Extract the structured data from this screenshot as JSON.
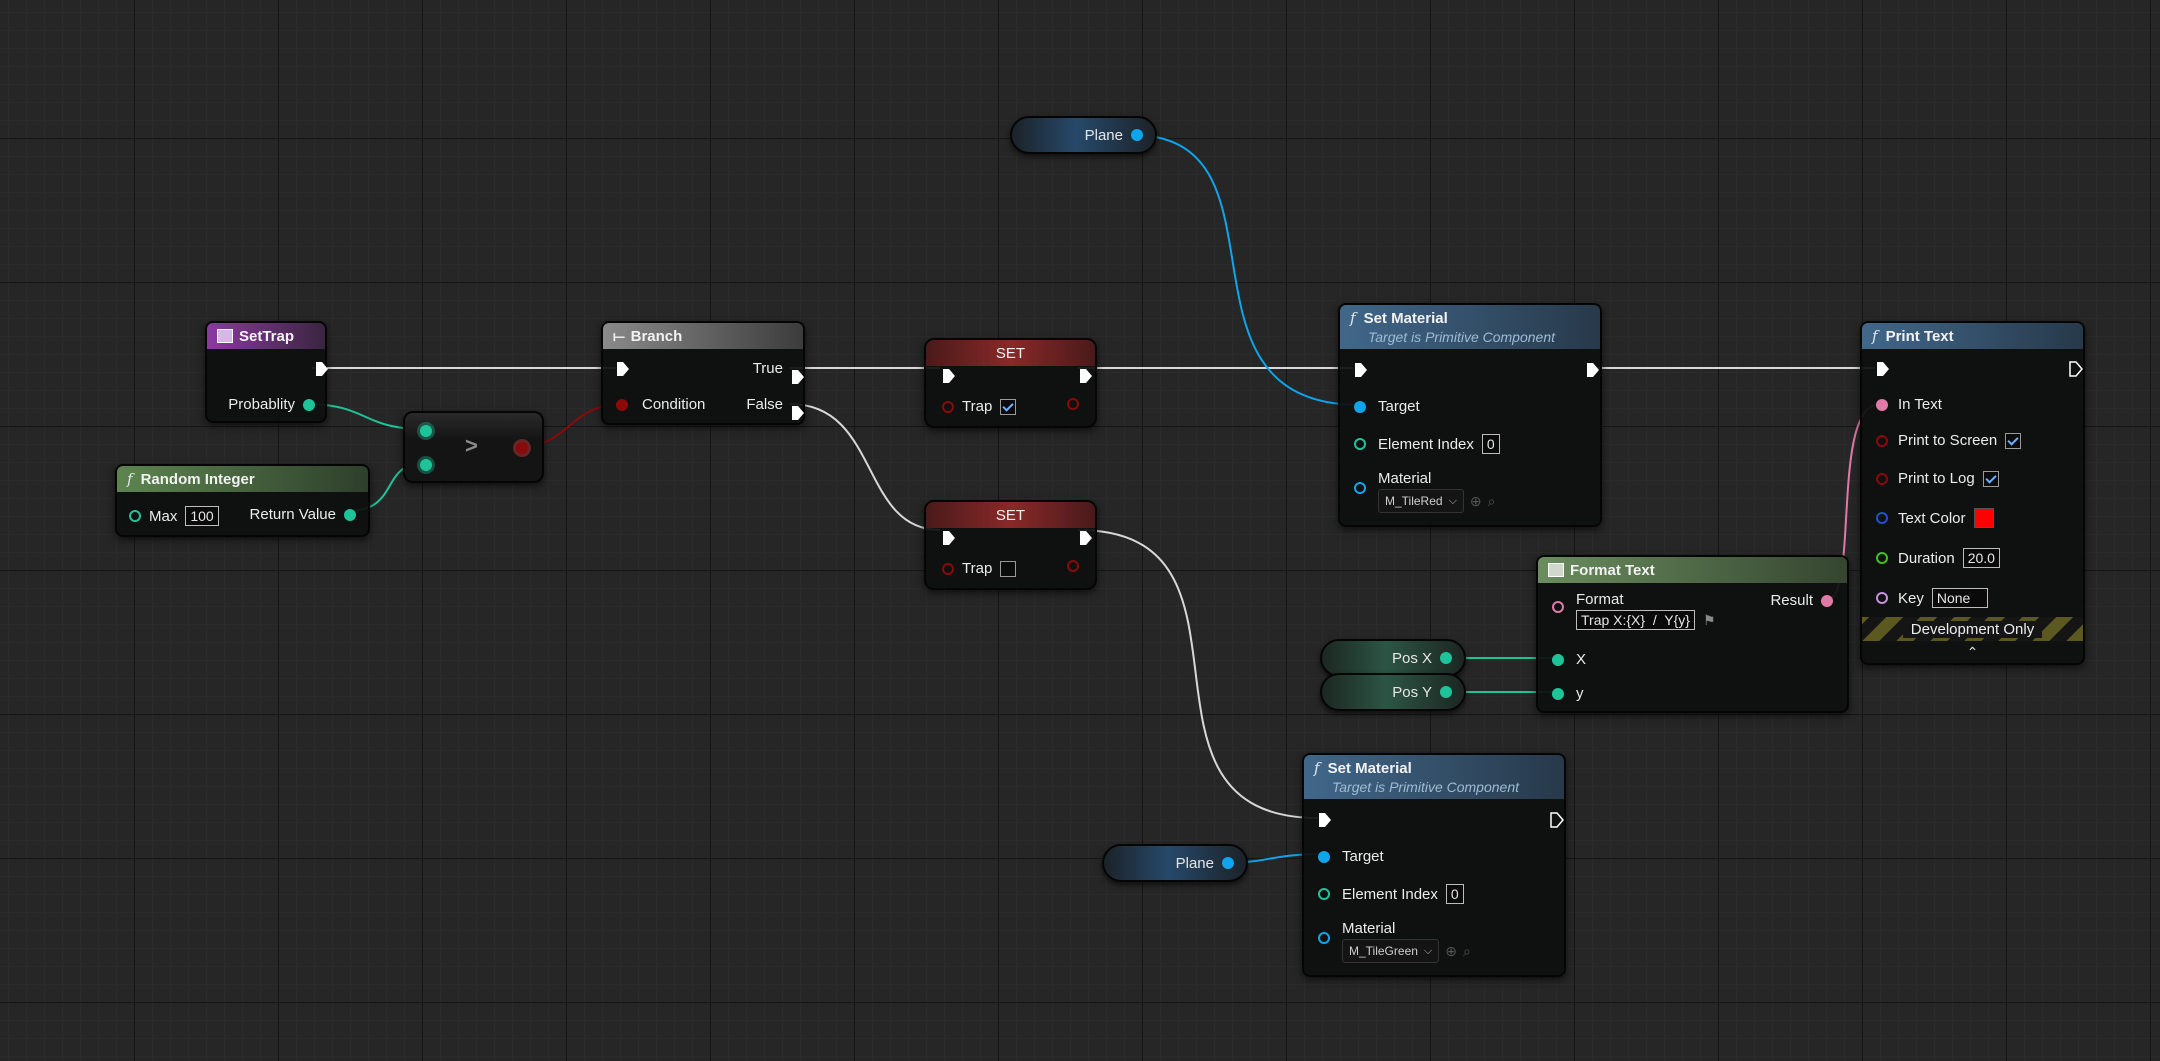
{
  "colors": {
    "exec": "#e8e8e8",
    "object": "#0ea5ea",
    "integer": "#1ec499",
    "boolean": "#8a0a0a",
    "text": "#e07aa8",
    "linear_color": "#1f52c9",
    "float": "#3fc21a",
    "name": "#c78fe0",
    "text_color_value": "#ff0000"
  },
  "nodes": {
    "settrap": {
      "title": "SetTrap",
      "icon": "event-icon",
      "out_label": "Probablity"
    },
    "random": {
      "title": "Random Integer",
      "max_label": "Max",
      "max_value": "100",
      "out_label": "Return Value"
    },
    "greater": {
      "symbol": ">"
    },
    "branch": {
      "title": "Branch",
      "condition_label": "Condition",
      "true_label": "True",
      "false_label": "False"
    },
    "set1": {
      "title": "SET",
      "var_label": "Trap",
      "checked": true
    },
    "set2": {
      "title": "SET",
      "var_label": "Trap",
      "checked": false
    },
    "setmat1": {
      "title": "Set Material",
      "subtitle": "Target is Primitive Component",
      "target_label": "Target",
      "index_label": "Element Index",
      "index_value": "0",
      "material_label": "Material",
      "material_value": "M_TileRed"
    },
    "setmat2": {
      "title": "Set Material",
      "subtitle": "Target is Primitive Component",
      "target_label": "Target",
      "index_label": "Element Index",
      "index_value": "0",
      "material_label": "Material",
      "material_value": "M_TileGreen"
    },
    "format": {
      "title": "Format Text",
      "format_label": "Format",
      "format_value": "Trap X:{X}  /  Y{y}",
      "result_label": "Result",
      "x_label": "X",
      "y_label": "y"
    },
    "print": {
      "title": "Print Text",
      "in_text": "In Text",
      "print_screen": "Print to Screen",
      "print_log": "Print to Log",
      "text_color": "Text Color",
      "duration": "Duration",
      "duration_value": "20.0",
      "key": "Key",
      "key_value": "None",
      "dev_only": "Development Only"
    }
  },
  "vars": {
    "plane1": "Plane",
    "plane2": "Plane",
    "posx": "Pos X",
    "posy": "Pos Y"
  }
}
